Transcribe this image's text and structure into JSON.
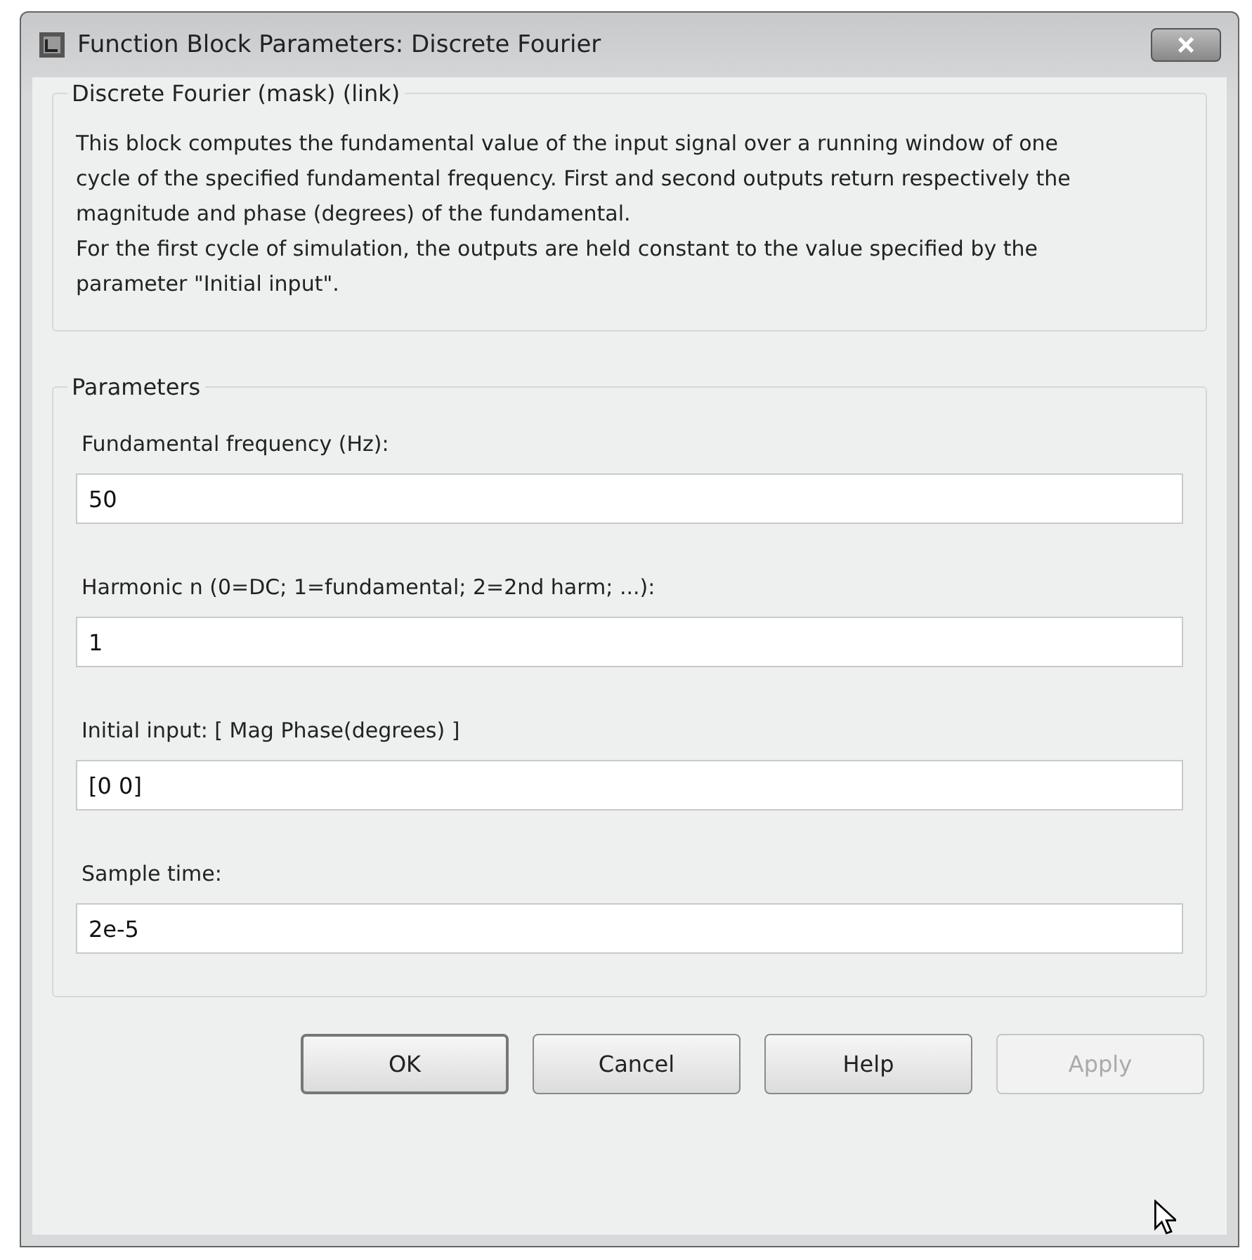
{
  "window": {
    "title": "Function Block Parameters: Discrete Fourier"
  },
  "description": {
    "title": "Discrete Fourier (mask) (link)",
    "paragraphs": [
      "This block computes the fundamental value of the input signal over a running window of one cycle of the specified fundamental frequency. First and second outputs return respectively the magnitude and phase (degrees) of the fundamental.",
      "For the first cycle of simulation, the outputs are held constant to the value specified by the parameter \"Initial input\"."
    ]
  },
  "parameters": {
    "title": "Parameters",
    "fields": [
      {
        "label": "Fundamental frequency (Hz):",
        "value": "50"
      },
      {
        "label": "Harmonic n (0=DC; 1=fundamental; 2=2nd harm;  ...):",
        "value": "1"
      },
      {
        "label": "Initial input: [ Mag  Phase(degrees) ]",
        "value": "[0 0]"
      },
      {
        "label": "Sample time:",
        "value": "2e-5"
      }
    ]
  },
  "buttons": [
    {
      "label": "OK",
      "disabled": false,
      "default": true
    },
    {
      "label": "Cancel",
      "disabled": false,
      "default": false
    },
    {
      "label": "Help",
      "disabled": false,
      "default": false
    },
    {
      "label": "Apply",
      "disabled": true,
      "default": false
    }
  ]
}
